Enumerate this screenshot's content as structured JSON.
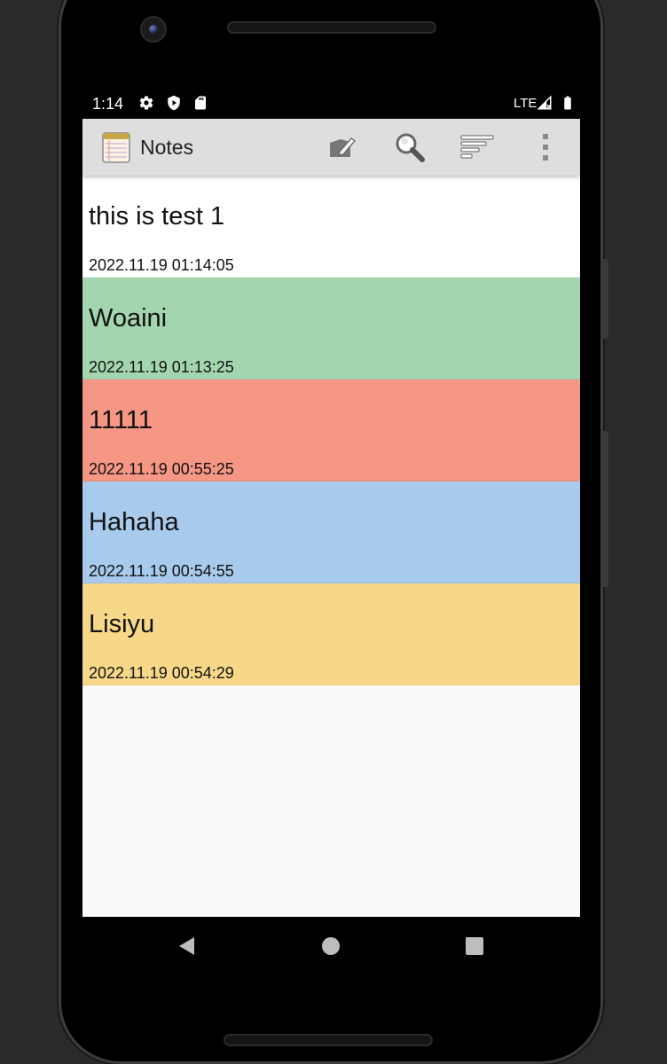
{
  "status_bar": {
    "time": "1:14",
    "network": "LTE",
    "icons": [
      "gear-icon",
      "shield-icon",
      "sd-card-icon",
      "signal-icon",
      "battery-icon"
    ]
  },
  "app_bar": {
    "title": "Notes",
    "actions": [
      "new-note-icon",
      "search-icon",
      "sort-icon",
      "more-vert-icon"
    ]
  },
  "notes": [
    {
      "title": "this is test 1",
      "timestamp": "2022.11.19 01:14:05",
      "color": "#ffffff"
    },
    {
      "title": "Woaini",
      "timestamp": "2022.11.19 01:13:25",
      "color": "#a3d6af"
    },
    {
      "title": "11111",
      "timestamp": "2022.11.19 00:55:25",
      "color": "#f69685"
    },
    {
      "title": "Hahaha",
      "timestamp": "2022.11.19 00:54:55",
      "color": "#a7caed"
    },
    {
      "title": "Lisiyu",
      "timestamp": "2022.11.19 00:54:29",
      "color": "#f7d888"
    }
  ],
  "nav_bar": {
    "buttons": [
      "back-icon",
      "home-icon",
      "recents-icon"
    ]
  }
}
